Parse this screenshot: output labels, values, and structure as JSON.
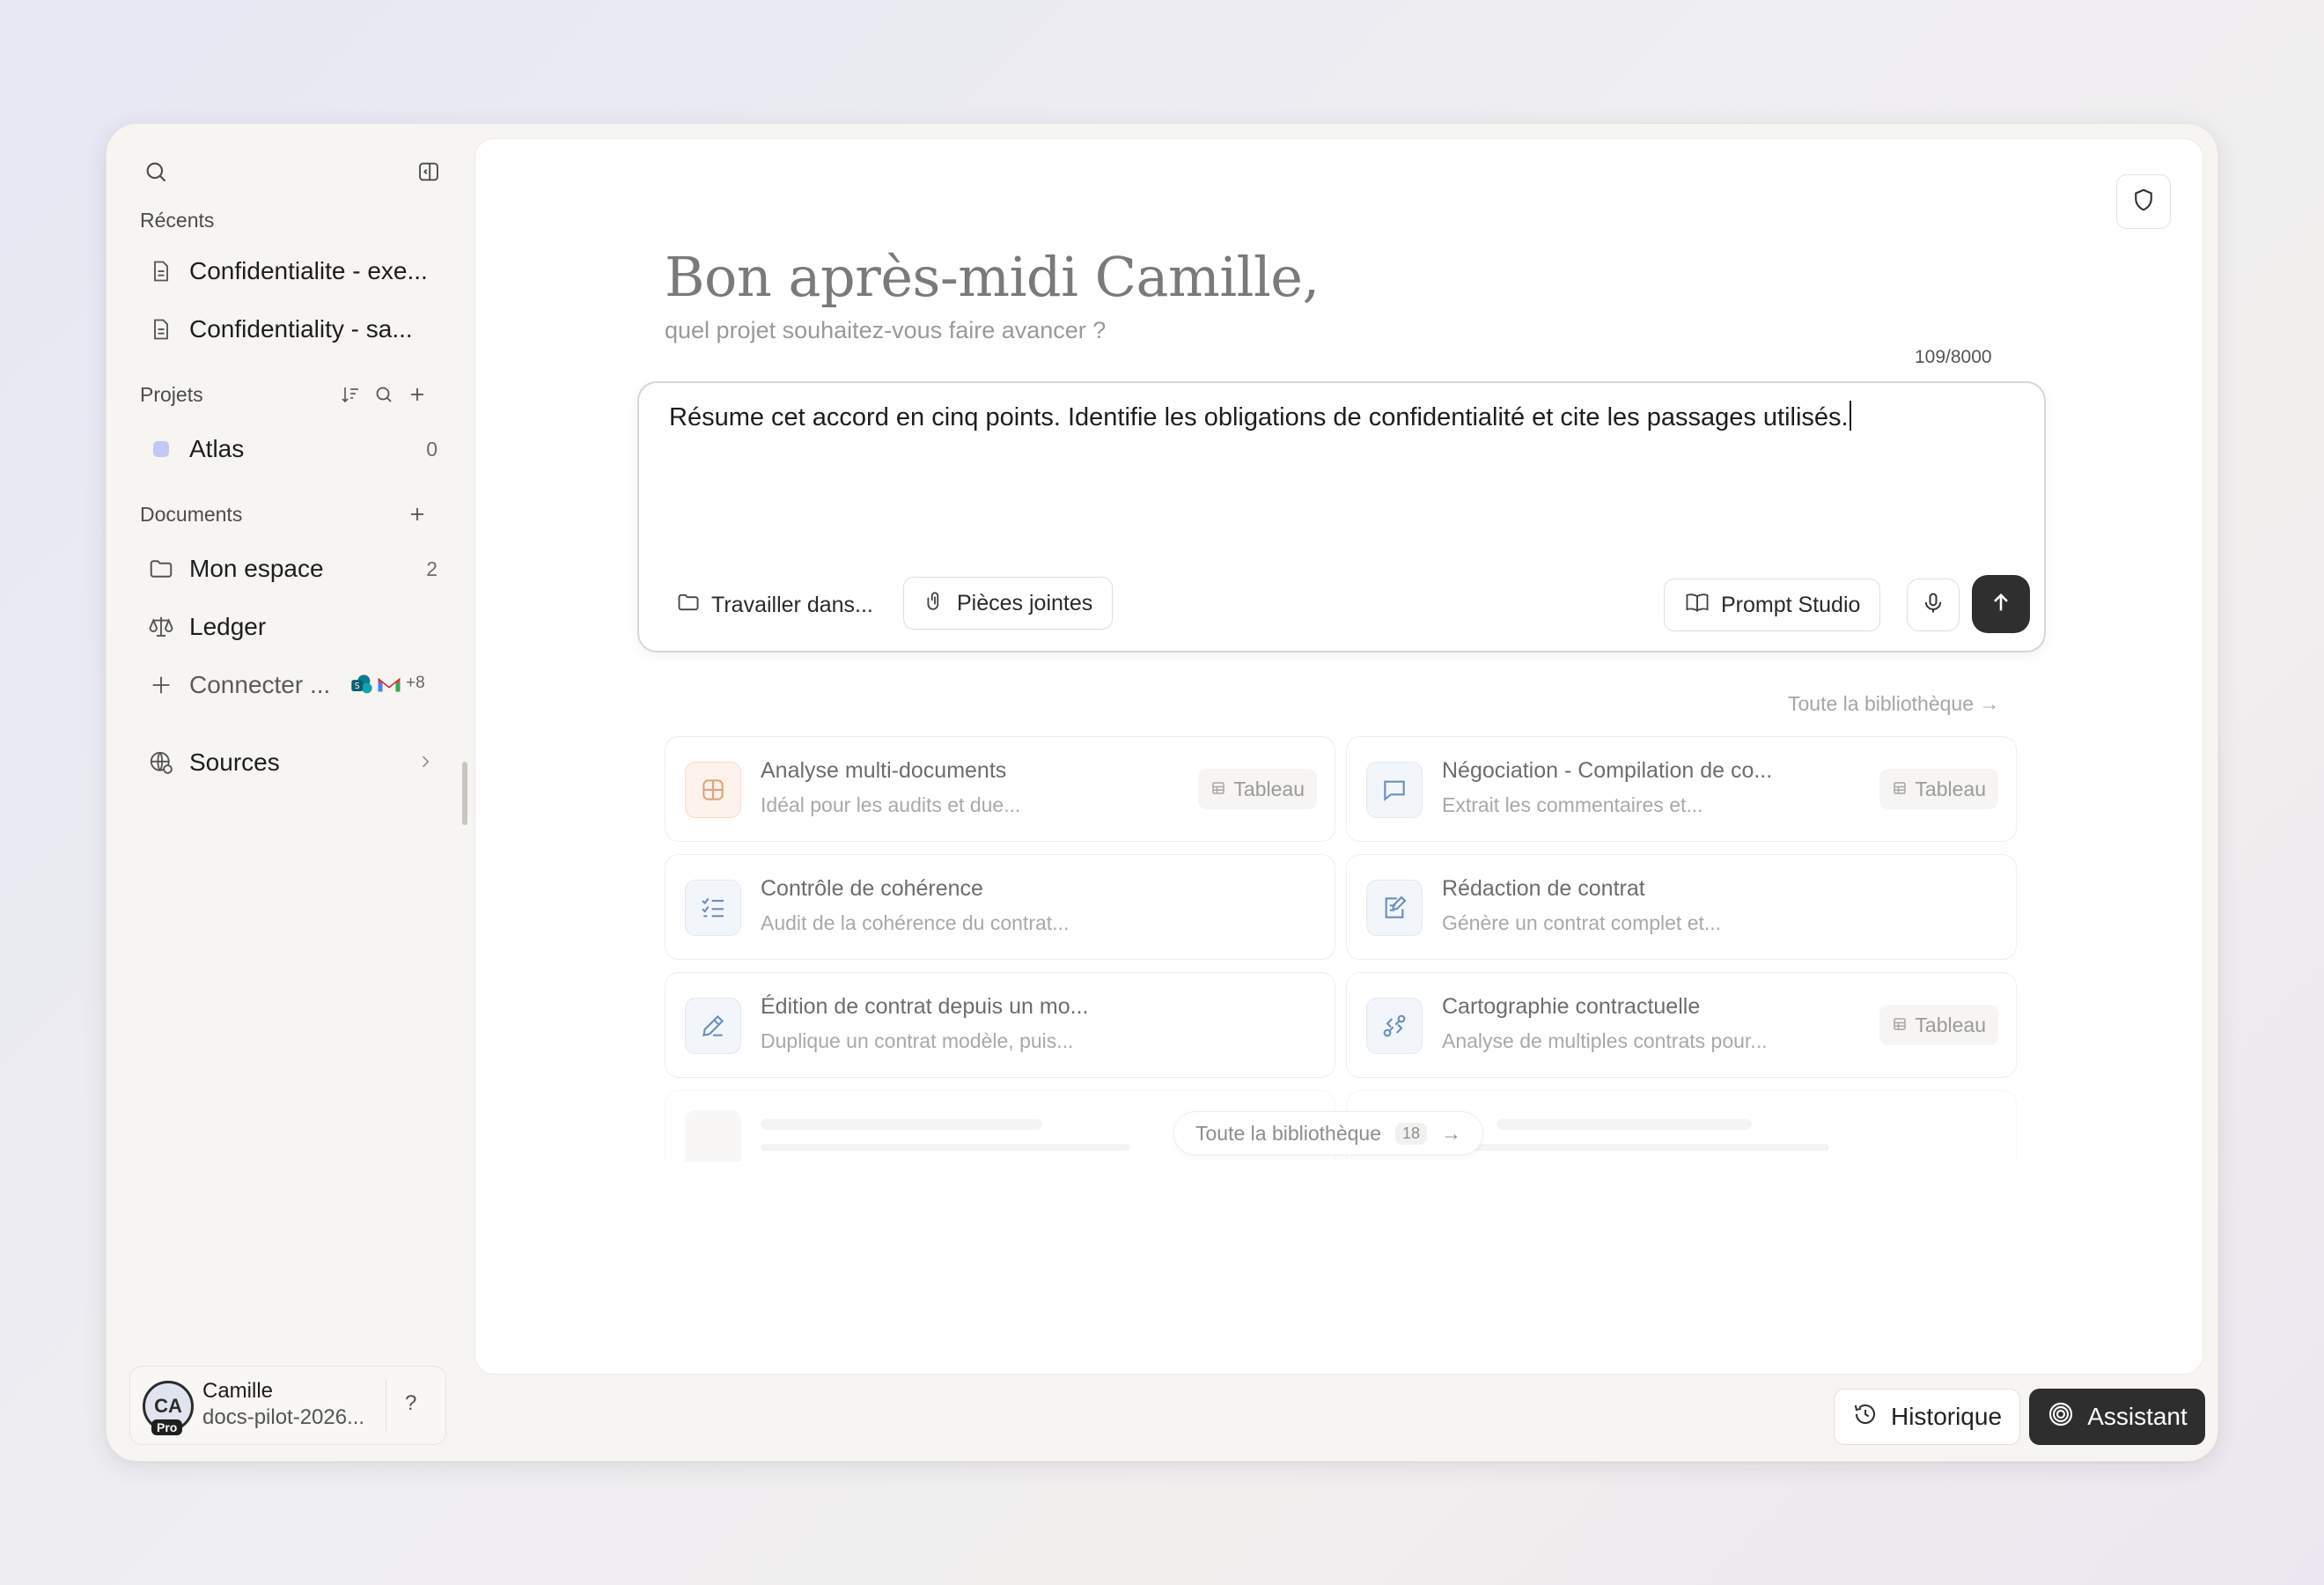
{
  "sidebar": {
    "recents_title": "Récents",
    "recents": [
      {
        "label": "Confidentialite - exe...",
        "icon": "document-icon"
      },
      {
        "label": "Confidentiality - sa...",
        "icon": "document-icon"
      }
    ],
    "projects_title": "Projets",
    "projects": [
      {
        "label": "Atlas",
        "count": "0",
        "color": "#c3c8f5"
      }
    ],
    "documents_title": "Documents",
    "documents": [
      {
        "label": "Mon espace",
        "count": "2",
        "icon": "folder-icon"
      },
      {
        "label": "Ledger",
        "icon": "scale-icon"
      }
    ],
    "connect": {
      "label": "Connecter ...",
      "extra": "+8"
    },
    "sources": {
      "label": "Sources"
    },
    "user": {
      "initials": "CA",
      "badge": "Pro",
      "name": "Camille",
      "workspace": "docs-pilot-2026...",
      "help": "?"
    }
  },
  "main": {
    "greeting": "Bon après-midi Camille,",
    "subtitle": "quel projet souhaitez-vous faire avancer ?",
    "counter": "109/8000",
    "prompt": "Résume cet accord en cinq points. Identifie les obligations de confidentialité et cite les passages utilisés.",
    "work_in_label": "Travailler dans...",
    "attachments_label": "Pièces jointes",
    "prompt_studio_label": "Prompt Studio",
    "library_link": "Toute la bibliothèque →",
    "cards": [
      {
        "title": "Analyse multi-documents",
        "desc": "Idéal pour les audits et due...",
        "tag": "Tableau",
        "icon": "grid-icon"
      },
      {
        "title": "Négociation - Compilation de co...",
        "desc": "Extrait les commentaires et...",
        "tag": "Tableau",
        "icon": "comment-icon"
      },
      {
        "title": "Contrôle de cohérence",
        "desc": "Audit de la cohérence du contrat...",
        "icon": "checklist-icon"
      },
      {
        "title": "Rédaction de contrat",
        "desc": "Génère un contrat complet et...",
        "icon": "edit-document-icon"
      },
      {
        "title": "Édition de contrat depuis un mo...",
        "desc": "Duplique un contrat modèle, puis...",
        "icon": "pencil-icon"
      },
      {
        "title": "Cartographie contractuelle",
        "desc": "Analyse de multiples contrats pour...",
        "tag": "Tableau",
        "icon": "link-icon"
      }
    ],
    "library_pill": {
      "label": "Toute la bibliothèque",
      "count": "18",
      "arrow": "→"
    }
  },
  "footer": {
    "history_label": "Historique",
    "assistant_label": "Assistant"
  },
  "colors": {
    "accent_dark": "#2e2e2e",
    "project_dot": "#c3c8f5"
  }
}
